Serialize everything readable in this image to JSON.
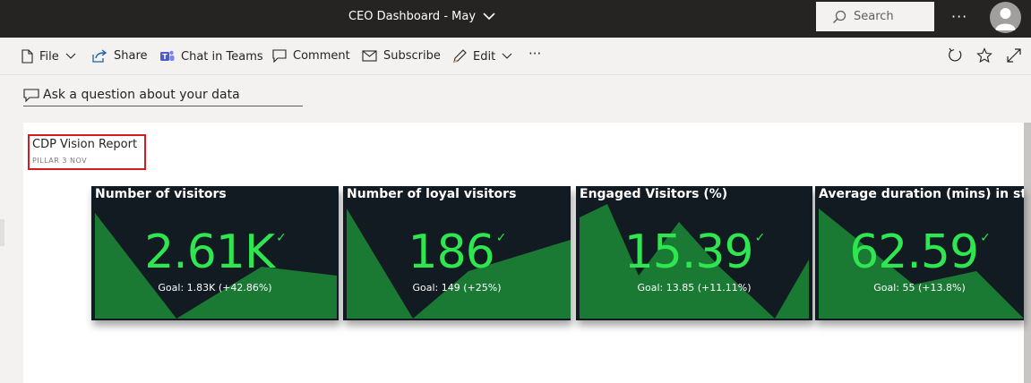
{
  "header": {
    "report_title": "CEO Dashboard - May",
    "search_placeholder": "Search",
    "more": "···"
  },
  "commands": {
    "file": "File",
    "share": "Share",
    "teams": "Chat in Teams",
    "comment": "Comment",
    "subscribe": "Subscribe",
    "edit": "Edit",
    "more": "···"
  },
  "qna": {
    "placeholder": "Ask a question about your data"
  },
  "report": {
    "title": "CDP Vision Report",
    "subtitle": "PILLAR 3 NOV"
  },
  "kpis": [
    {
      "label": "Number of visitors",
      "value": "2.61K",
      "goal": "Goal: 1.83K (+42.86%)"
    },
    {
      "label": "Number of loyal visitors",
      "value": "186",
      "goal": "Goal: 149 (+25%)"
    },
    {
      "label": "Engaged Visitors (%)",
      "value": "15.39",
      "goal": "Goal: 13.85 (+11.11%)"
    },
    {
      "label": "Average duration (mins) in store",
      "value": "62.59",
      "goal": "Goal: 55 (+13.8%)"
    }
  ],
  "colors": {
    "topbar": "#252423",
    "kpi_background": "#121a22",
    "kpi_value": "#2ee64f",
    "kpi_area": "#1a7a34",
    "highlight_border": "#d71921"
  }
}
